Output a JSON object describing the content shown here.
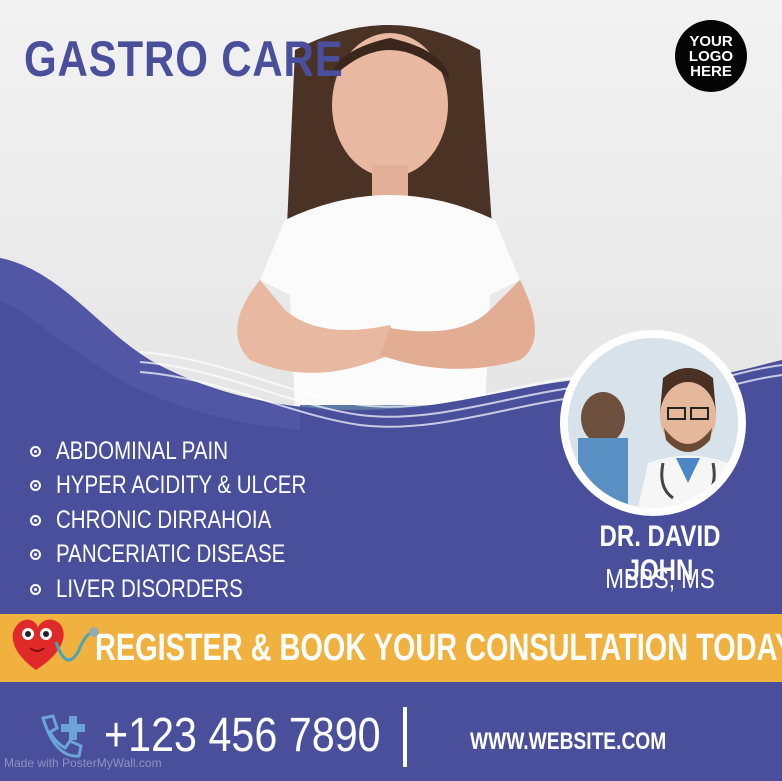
{
  "header": {
    "title": "GASTRO CARE",
    "logo_lines": [
      "YOUR",
      "LOGO",
      "HERE"
    ]
  },
  "conditions": [
    "ABDOMINAL PAIN",
    "HYPER ACIDITY & ULCER",
    "CHRONIC DIRRAHOIA",
    "PANCERIATIC DISEASE",
    "LIVER DISORDERS"
  ],
  "doctor": {
    "name": "DR. DAVID JOHN",
    "qualifications": "MBBS, MS"
  },
  "cta": {
    "text": "REGISTER & BOOK YOUR  CONSULTATION TODAY!"
  },
  "footer": {
    "phone": "+123 456 7890",
    "website": "WWW.WEBSITE.COM",
    "watermark": "Made with PosterMyWall.com"
  },
  "icons": [
    "heart-stethoscope-icon",
    "phone-plus-icon",
    "bullet-icon"
  ],
  "colors": {
    "primary": "#4a4f9c",
    "accent": "#f0b13f",
    "white": "#ffffff",
    "logo_bg": "#050505"
  }
}
